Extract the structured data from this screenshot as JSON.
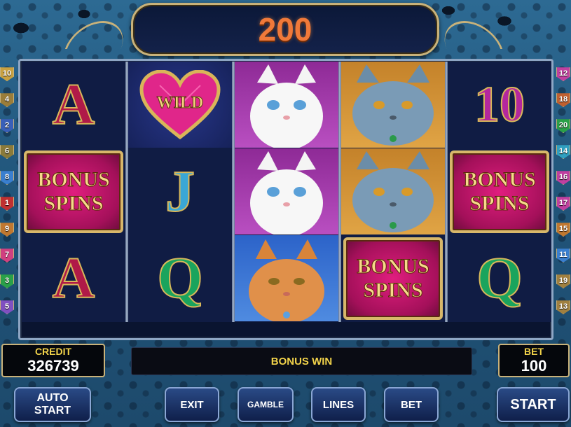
{
  "win_display": {
    "amount": "200"
  },
  "reels": [
    [
      "A",
      "BONUS SPINS",
      "A"
    ],
    [
      "WILD",
      "J",
      "Q"
    ],
    [
      "white-cat",
      "white-cat",
      "orange-cat"
    ],
    [
      "gray-cat",
      "gray-cat",
      "BONUS SPINS"
    ],
    [
      "10",
      "BONUS SPINS",
      "Q"
    ]
  ],
  "symbols": {
    "A": "A",
    "J": "J",
    "Q": "Q",
    "ten": "10",
    "bonus_line1": "BONUS",
    "bonus_line2": "SPINS",
    "wild": "WILD"
  },
  "line_markers_left": [
    {
      "label": "10",
      "color": "#c8a040"
    },
    {
      "label": "4",
      "color": "#9a7d3a"
    },
    {
      "label": "2",
      "color": "#3a5fb8"
    },
    {
      "label": "6",
      "color": "#8a7a3a"
    },
    {
      "label": "8",
      "color": "#3a7fcf"
    },
    {
      "label": "1",
      "color": "#c03030"
    },
    {
      "label": "9",
      "color": "#c07830"
    },
    {
      "label": "7",
      "color": "#d04080"
    },
    {
      "label": "3",
      "color": "#2aa048"
    },
    {
      "label": "5",
      "color": "#8050c0"
    }
  ],
  "line_markers_right": [
    {
      "label": "12",
      "color": "#c040a0"
    },
    {
      "label": "18",
      "color": "#c06030"
    },
    {
      "label": "20",
      "color": "#2aa048"
    },
    {
      "label": "14",
      "color": "#30a0c0"
    },
    {
      "label": "16",
      "color": "#c040a0"
    },
    {
      "label": "17",
      "color": "#c040a0"
    },
    {
      "label": "15",
      "color": "#c07830"
    },
    {
      "label": "11",
      "color": "#3a7fcf"
    },
    {
      "label": "19",
      "color": "#a08040"
    },
    {
      "label": "13",
      "color": "#a08040"
    }
  ],
  "credit": {
    "label": "CREDIT",
    "value": "326739"
  },
  "message": "BONUS WIN",
  "bet": {
    "label": "BET",
    "value": "100"
  },
  "buttons": {
    "auto_start_line1": "AUTO",
    "auto_start_line2": "START",
    "exit": "EXIT",
    "gamble": "GAMBLE",
    "lines": "LINES",
    "bet": "BET",
    "start": "START"
  },
  "colors": {
    "win_amount": "#f0793a",
    "label_yellow": "#f2d34a",
    "frame_gold": "#c9b27a",
    "button_blue": "#0f1f4a"
  }
}
